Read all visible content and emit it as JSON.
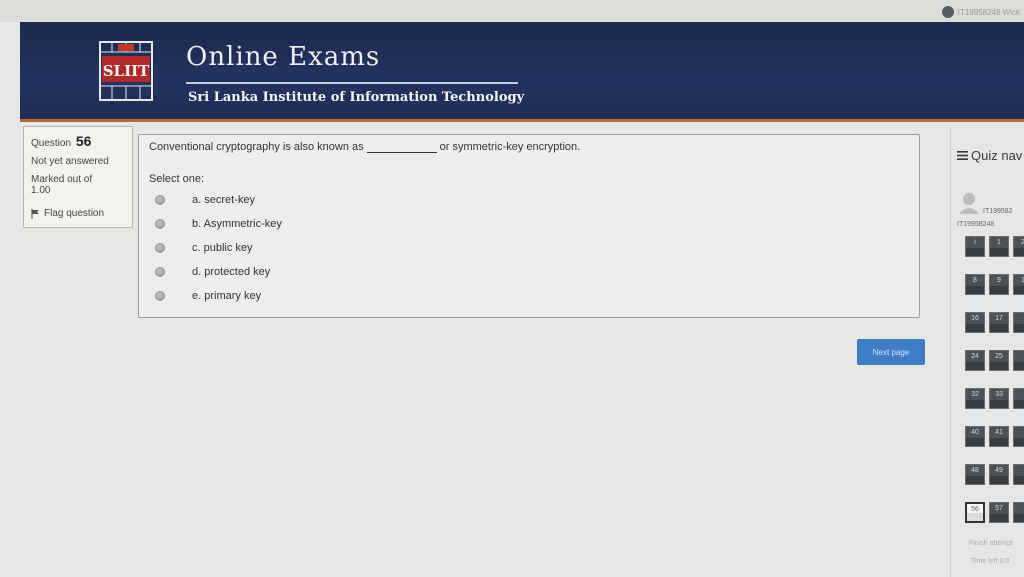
{
  "topbar": {
    "user_name": "IT19958248 Wick"
  },
  "header": {
    "logo_text": "SLIIT",
    "site_title": "Online Exams",
    "subtitle": "Sri Lanka Institute of Information Technology",
    "colors": {
      "band": "#233360",
      "accent_rule": "#b7692e"
    }
  },
  "question_info": {
    "question_label": "Question",
    "question_number": "56",
    "status": "Not yet answered",
    "marked_label": "Marked out of",
    "marked_value": "1.00",
    "flag_label": "Flag question"
  },
  "question": {
    "text_before": "Conventional cryptography is also known as",
    "text_after": "or symmetric-key encryption.",
    "select_one_label": "Select one:",
    "options": [
      {
        "label": "a. secret-key"
      },
      {
        "label": "b. Asymmetric-key"
      },
      {
        "label": "c. public key"
      },
      {
        "label": "d. protected key"
      },
      {
        "label": "e. primary key"
      }
    ]
  },
  "next_button_label": "Next page",
  "quiz_nav": {
    "title": "Quiz nav",
    "user_id_short": "IT199582",
    "user_id": "IT19958248",
    "cells": [
      "i",
      "1",
      "2",
      "8",
      "9",
      "1",
      "16",
      "17",
      "",
      "24",
      "25",
      "",
      "32",
      "33",
      "",
      "40",
      "41",
      "",
      "48",
      "49",
      "",
      "56",
      "57",
      ""
    ],
    "current_index": 21,
    "finish_label": "Finish attempt",
    "time_left_label": "Time left 0:0"
  }
}
